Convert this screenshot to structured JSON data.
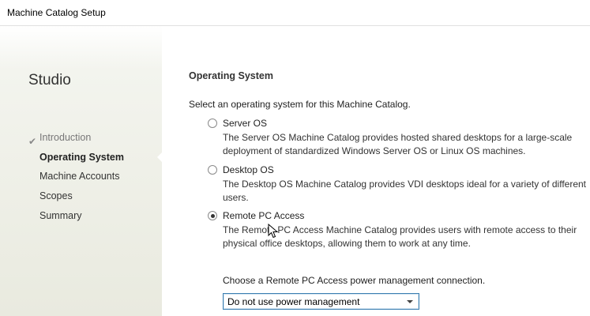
{
  "window": {
    "title": "Machine Catalog Setup"
  },
  "sidebar": {
    "heading": "Studio",
    "items": [
      {
        "label": "Introduction",
        "state": "completed"
      },
      {
        "label": "Operating System",
        "state": "active"
      },
      {
        "label": "Machine Accounts",
        "state": "pending"
      },
      {
        "label": "Scopes",
        "state": "pending"
      },
      {
        "label": "Summary",
        "state": "pending"
      }
    ]
  },
  "main": {
    "section_title": "Operating System",
    "intro": "Select an operating system for this Machine Catalog.",
    "options": [
      {
        "label": "Server OS",
        "description": "The Server OS Machine Catalog provides hosted shared desktops for a large-scale deployment of standardized Windows Server OS or Linux OS machines.",
        "selected": false
      },
      {
        "label": "Desktop OS",
        "description": "The Desktop OS Machine Catalog provides VDI desktops ideal for a variety of different users.",
        "selected": false
      },
      {
        "label": "Remote PC Access",
        "description": "The Remote PC Access Machine Catalog provides users with remote access to their physical office desktops, allowing them to work at any time.",
        "selected": true
      }
    ],
    "power_management": {
      "label": "Choose a Remote PC Access power management connection.",
      "selected": "Do not use power management"
    }
  },
  "colors": {
    "accent_border": "#3c7fb1",
    "sidebar_bg": "#e9eadf"
  }
}
